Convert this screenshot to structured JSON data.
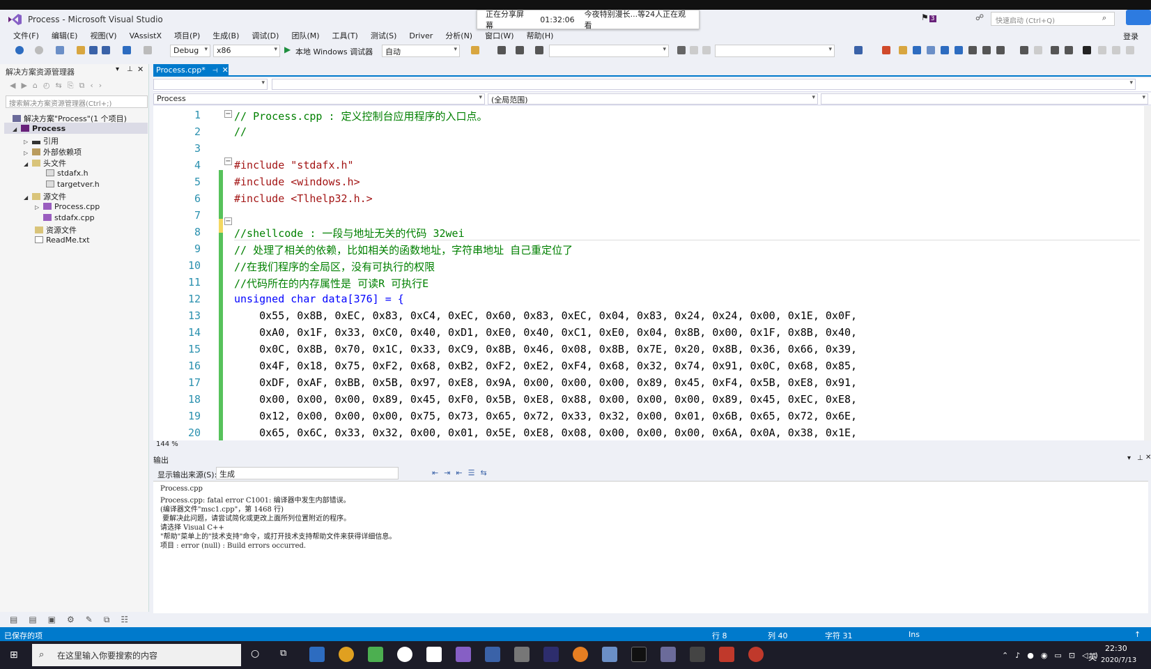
{
  "titlebar": {
    "title": "Process - Microsoft Visual Studio",
    "share_status": "正在分享屏幕",
    "share_time": "01:32:06",
    "share_viewers": "今夜特别漫长...等24人正在观看",
    "quick_launch": "快速启动 (Ctrl+Q)",
    "notification_count": "3",
    "login": "登录"
  },
  "menu": [
    "文件(F)",
    "编辑(E)",
    "视图(V)",
    "VAssistX",
    "项目(P)",
    "生成(B)",
    "调试(D)",
    "团队(M)",
    "工具(T)",
    "测试(S)",
    "Driver",
    "分析(N)",
    "窗口(W)",
    "帮助(H)"
  ],
  "toolbar": {
    "config": "Debug",
    "platform": "x86",
    "debugger": "本地 Windows 调试器",
    "auto": "自动"
  },
  "solution_explorer": {
    "title": "解决方案资源管理器",
    "search_placeholder": "搜索解决方案资源管理器(Ctrl+;)",
    "items": [
      {
        "label": "解决方案\"Process\"(1 个项目)"
      },
      {
        "label": "Process"
      },
      {
        "label": "引用"
      },
      {
        "label": "外部依赖项"
      },
      {
        "label": "头文件"
      },
      {
        "label": "stdafx.h"
      },
      {
        "label": "targetver.h"
      },
      {
        "label": "源文件"
      },
      {
        "label": "Process.cpp"
      },
      {
        "label": "stdafx.cpp"
      },
      {
        "label": "资源文件"
      },
      {
        "label": "ReadMe.txt"
      }
    ]
  },
  "editor": {
    "tab_label": "Process.cpp*",
    "project_scope": "Process",
    "global_scope": "(全局范围)",
    "zoom": "144 %",
    "lines": [
      {
        "n": "1",
        "text": "// Process.cpp : 定义控制台应用程序的入口点。"
      },
      {
        "n": "2",
        "text": "//"
      },
      {
        "n": "3",
        "text": ""
      },
      {
        "n": "4",
        "text": "#include \"stdafx.h\""
      },
      {
        "n": "5",
        "text": "#include <windows.h>"
      },
      {
        "n": "6",
        "text": "#include <Tlhelp32.h.>"
      },
      {
        "n": "7",
        "text": ""
      },
      {
        "n": "8",
        "text": "//shellcode : 一段与地址无关的代码 32wei"
      },
      {
        "n": "9",
        "text": "// 处理了相关的依赖，比如相关的函数地址，字符串地址 自己重定位了"
      },
      {
        "n": "10",
        "text": "//在我们程序的全局区，没有可执行的权限"
      },
      {
        "n": "11",
        "text": "//代码所在的内存属性是 可读R 可执行E"
      },
      {
        "n": "12",
        "text": "unsigned char data[376] = {"
      },
      {
        "n": "13",
        "text": "    0x55, 0x8B, 0xEC, 0x83, 0xC4, 0xEC, 0x60, 0x83, 0xEC, 0x04, 0x83, 0x24, 0x24, 0x00, 0x1E, 0x0F,"
      },
      {
        "n": "14",
        "text": "    0xA0, 0x1F, 0x33, 0xC0, 0x40, 0xD1, 0xE0, 0x40, 0xC1, 0xE0, 0x04, 0x8B, 0x00, 0x1F, 0x8B, 0x40,"
      },
      {
        "n": "15",
        "text": "    0x0C, 0x8B, 0x70, 0x1C, 0x33, 0xC9, 0x8B, 0x46, 0x08, 0x8B, 0x7E, 0x20, 0x8B, 0x36, 0x66, 0x39,"
      },
      {
        "n": "16",
        "text": "    0x4F, 0x18, 0x75, 0xF2, 0x68, 0xB2, 0xF2, 0xE2, 0xF4, 0x68, 0x32, 0x74, 0x91, 0x0C, 0x68, 0x85,"
      },
      {
        "n": "17",
        "text": "    0xDF, 0xAF, 0xBB, 0x5B, 0x97, 0xE8, 0x9A, 0x00, 0x00, 0x00, 0x89, 0x45, 0xF4, 0x5B, 0xE8, 0x91,"
      },
      {
        "n": "18",
        "text": "    0x00, 0x00, 0x00, 0x89, 0x45, 0xF0, 0x5B, 0xE8, 0x88, 0x00, 0x00, 0x00, 0x89, 0x45, 0xEC, 0xE8,"
      },
      {
        "n": "19",
        "text": "    0x12, 0x00, 0x00, 0x00, 0x75, 0x73, 0x65, 0x72, 0x33, 0x32, 0x00, 0x01, 0x6B, 0x65, 0x72, 0x6E,"
      },
      {
        "n": "20",
        "text": "    0x65, 0x6C, 0x33, 0x32, 0x00, 0x01, 0x5E, 0xE8, 0x08, 0x00, 0x00, 0x00, 0x6A, 0x0A, 0x38, 0x1E,"
      }
    ]
  },
  "output": {
    "title": "输出",
    "source_label": "显示输出来源(S):",
    "source_value": "生成",
    "lines": [
      "Process.cpp",
      "Process.cpp: fatal error C1001: 编译器中发生内部错误。",
      "(编译器文件\"msc1.cpp\"，第 1468 行)",
      " 要解决此问题，请尝试简化或更改上面所列位置附近的程序。",
      "请选择 Visual C++",
      "\"帮助\"菜单上的\"技术支持\"命令，或打开技术支持帮助文件来获得详细信息。",
      "项目 : error (null) : Build errors occurred."
    ]
  },
  "statusbar": {
    "message": "已保存的项",
    "row": "行 8",
    "col": "列 40",
    "char": "字符 31",
    "mode": "Ins"
  },
  "taskbar": {
    "search_placeholder": "在这里输入你要搜索的内容",
    "time": "22:30",
    "date": "2020/7/13",
    "ime": "英"
  },
  "colors": {
    "accent": "#007acc",
    "comment": "#008000",
    "keyword": "#0000ff",
    "linenum": "#2b91af",
    "change_bar": "#57c25b"
  }
}
